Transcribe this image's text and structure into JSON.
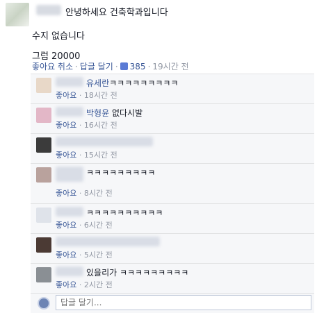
{
  "post": {
    "headline": "안녕하세요 건축학과입니다",
    "line2": "수지 없습니다",
    "line3": "그럼 20000",
    "unlike": "좋아요 취소",
    "reply": "답글 달기",
    "like_count": "385",
    "time": "19시간 전"
  },
  "comments": [
    {
      "name": "유세란",
      "text": "ㅋㅋㅋㅋㅋㅋㅋㅋㅋ",
      "like": "좋아요",
      "time": "18시간 전",
      "avatar_color": "#e8d8c8"
    },
    {
      "name": "박형윤",
      "text": "없다시발",
      "like": "좋아요",
      "time": "16시간 전",
      "avatar_color": "#e3b7c7"
    },
    {
      "name": "",
      "text": "",
      "like": "좋아요",
      "time": "15시간 전",
      "avatar_color": "#3b3b3b"
    },
    {
      "name": "",
      "text": "ㅋㅋㅋㅋㅋㅋㅋㅋㅋ",
      "like": "좋아요",
      "time": "8시간 전",
      "avatar_color": "#b9a29d"
    },
    {
      "name": "",
      "text": "ㅋㅋㅋㅋㅋㅋㅋㅋㅋㅋ",
      "like": "좋아요",
      "time": "6시간 전",
      "avatar_color": "#dfe3ea"
    },
    {
      "name": "",
      "text": "",
      "like": "좋아요",
      "time": "5시간 전",
      "avatar_color": "#4b3a34"
    },
    {
      "name": "",
      "text": "있을리가 ㅋㅋㅋㅋㅋㅋㅋㅋㅋ",
      "like": "좋아요",
      "time": "2시간 전",
      "avatar_color": "#8a8f94"
    }
  ],
  "reply_placeholder": "답글 달기..."
}
